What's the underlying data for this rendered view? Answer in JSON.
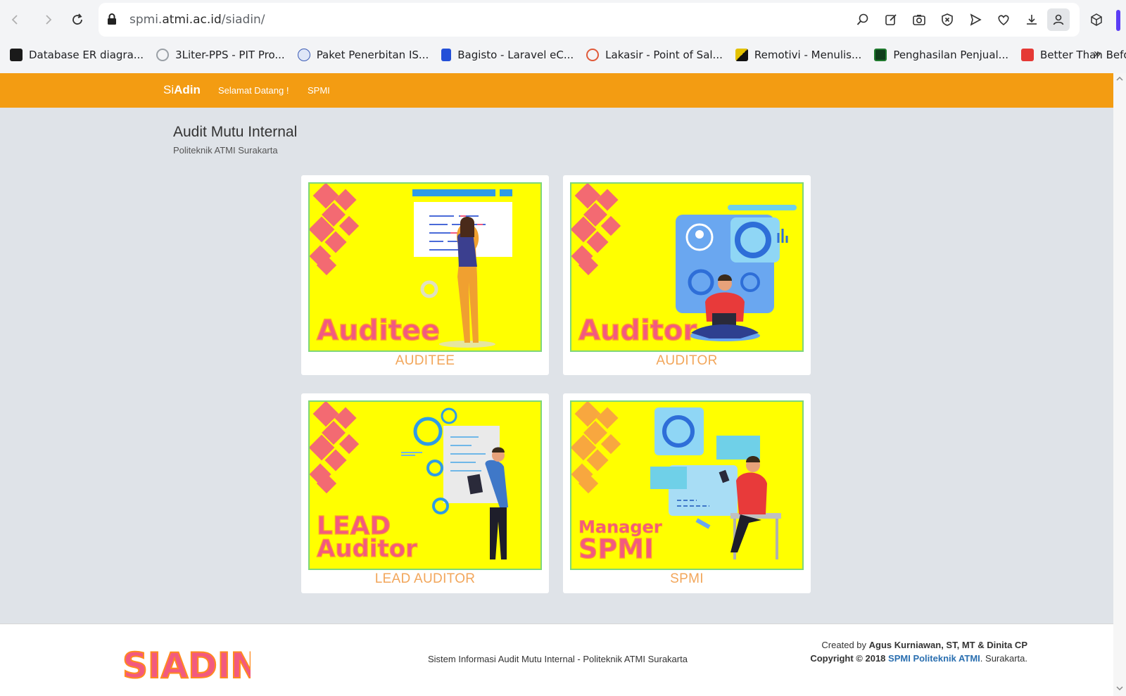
{
  "browser": {
    "url_host_prefix": "spmi.",
    "url_host_main": "atmi.ac.id",
    "url_path": "/siadin/",
    "bookmarks": [
      {
        "label": "Database ER diagra...",
        "color": "#1a1a1a"
      },
      {
        "label": "3Liter-PPS - PIT Pro...",
        "color": "#9aa0a6"
      },
      {
        "label": "Paket Penerbitan IS...",
        "color": "#3b5bb5"
      },
      {
        "label": "Bagisto - Laravel eC...",
        "color": "#2450d8"
      },
      {
        "label": "Lakasir - Point of Sal...",
        "color": "#e05a3a"
      },
      {
        "label": "Remotivi - Menulis...",
        "color": "#e3c100"
      },
      {
        "label": "Penghasilan Penjual...",
        "color": "#1f7a2e"
      },
      {
        "label": "Better Than Before,...",
        "color": "#e53935"
      }
    ]
  },
  "nav": {
    "brand_si": "Si",
    "brand_adin": "Adin",
    "links": [
      "Selamat Datang !",
      "SPMI"
    ],
    "color": "#f39c12"
  },
  "header": {
    "title": "Audit Mutu Internal",
    "subtitle": "Politeknik ATMI Surakarta"
  },
  "cards": [
    {
      "label": "AUDITEE",
      "art_text": "Auditee"
    },
    {
      "label": "AUDITOR",
      "art_text": "Auditor"
    },
    {
      "label": "LEAD AUDITOR",
      "art_text_line1": "LEAD",
      "art_text_line2": "Auditor"
    },
    {
      "label": "SPMI",
      "art_text_line1": "Manager",
      "art_text_line2": "SPMI"
    }
  ],
  "footer": {
    "logo_text": "SIADIN",
    "center": "Sistem Informasi Audit Mutu Internal - Politeknik ATMI Surakarta",
    "created_prefix": "Created by",
    "created_names": "Agus Kurniawan, ST, MT & Dinita CP",
    "copyright": "Copyright © 2018",
    "org_link": "SPMI Politeknik ATMI",
    "city": ". Surakarta."
  }
}
